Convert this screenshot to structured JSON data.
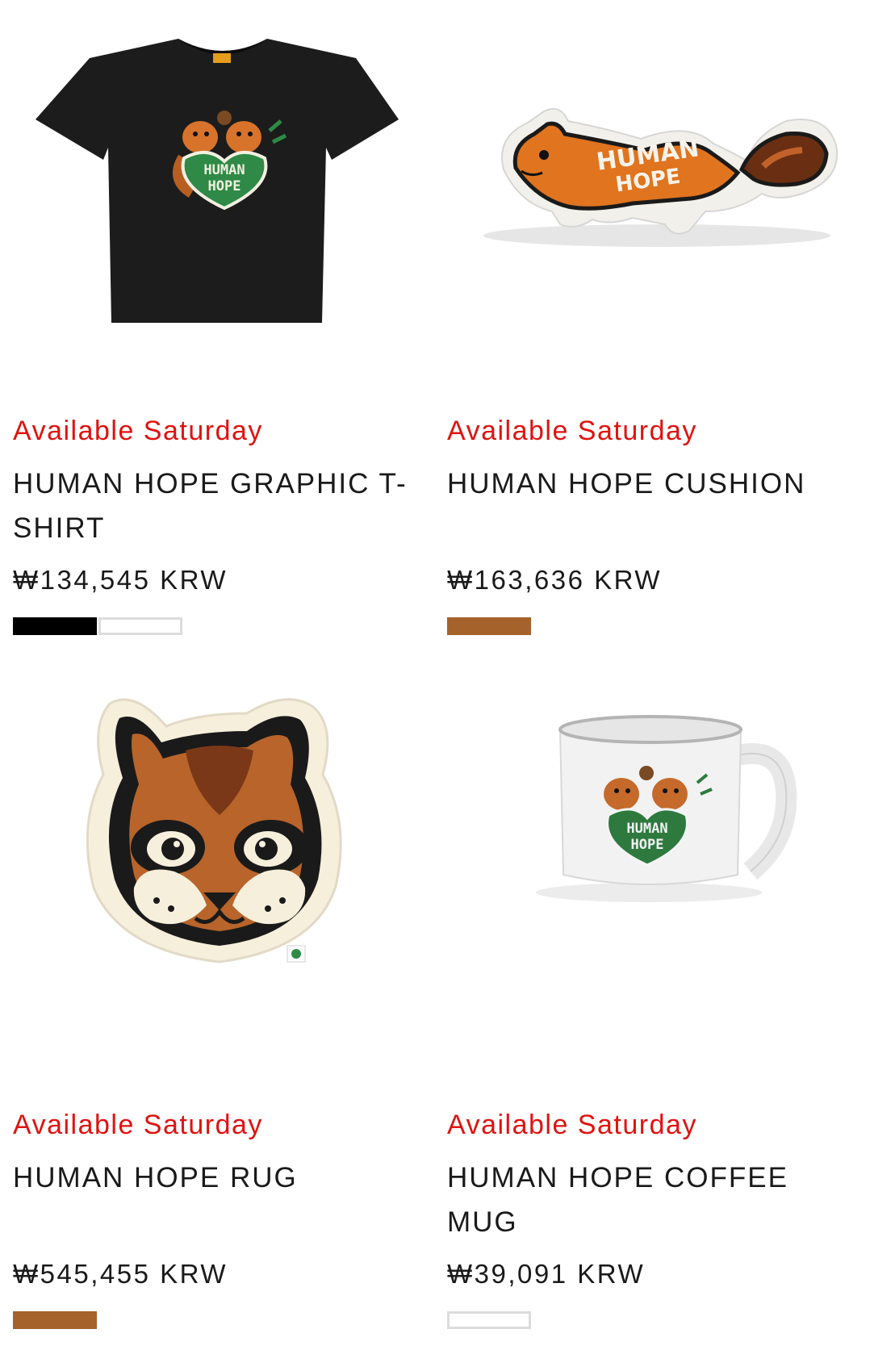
{
  "products": [
    {
      "availability": "Available Saturday",
      "title": "HUMAN HOPE GRAPHIC T-SHIRT",
      "title_line1": "HUMAN HOPE GRAPHIC T-",
      "title_line2": "SHIRT",
      "price": "₩134,545 KRW",
      "image_icon": "black-graphic-tshirt-image",
      "image_text": "HUMAN HOPE",
      "swatches": [
        {
          "name": "black",
          "color": "#000000"
        },
        {
          "name": "white",
          "color": "#ffffff"
        }
      ]
    },
    {
      "availability": "Available Saturday",
      "title": "HUMAN HOPE CUSHION",
      "price": "₩163,636 KRW",
      "image_icon": "squirrel-cushion-image",
      "image_text": "HUMAN HOPE",
      "swatches": [
        {
          "name": "brown",
          "color": "#a5622a"
        }
      ]
    },
    {
      "availability": "Available Saturday",
      "title": "HUMAN HOPE RUG",
      "price": "₩545,455 KRW",
      "image_icon": "squirrel-face-rug-image",
      "swatches": [
        {
          "name": "brown",
          "color": "#a5622a"
        }
      ]
    },
    {
      "availability": "Available Saturday",
      "title": "HUMAN HOPE COFFEE MUG",
      "price": "₩39,091 KRW",
      "image_icon": "coffee-mug-image",
      "image_text": "HUMAN HOPE",
      "swatches": [
        {
          "name": "white",
          "color": "#ffffff"
        }
      ]
    }
  ],
  "colors": {
    "availability": "#e0120f",
    "text": "#1a1a1a",
    "swatch_border": "#dcdcdc"
  }
}
